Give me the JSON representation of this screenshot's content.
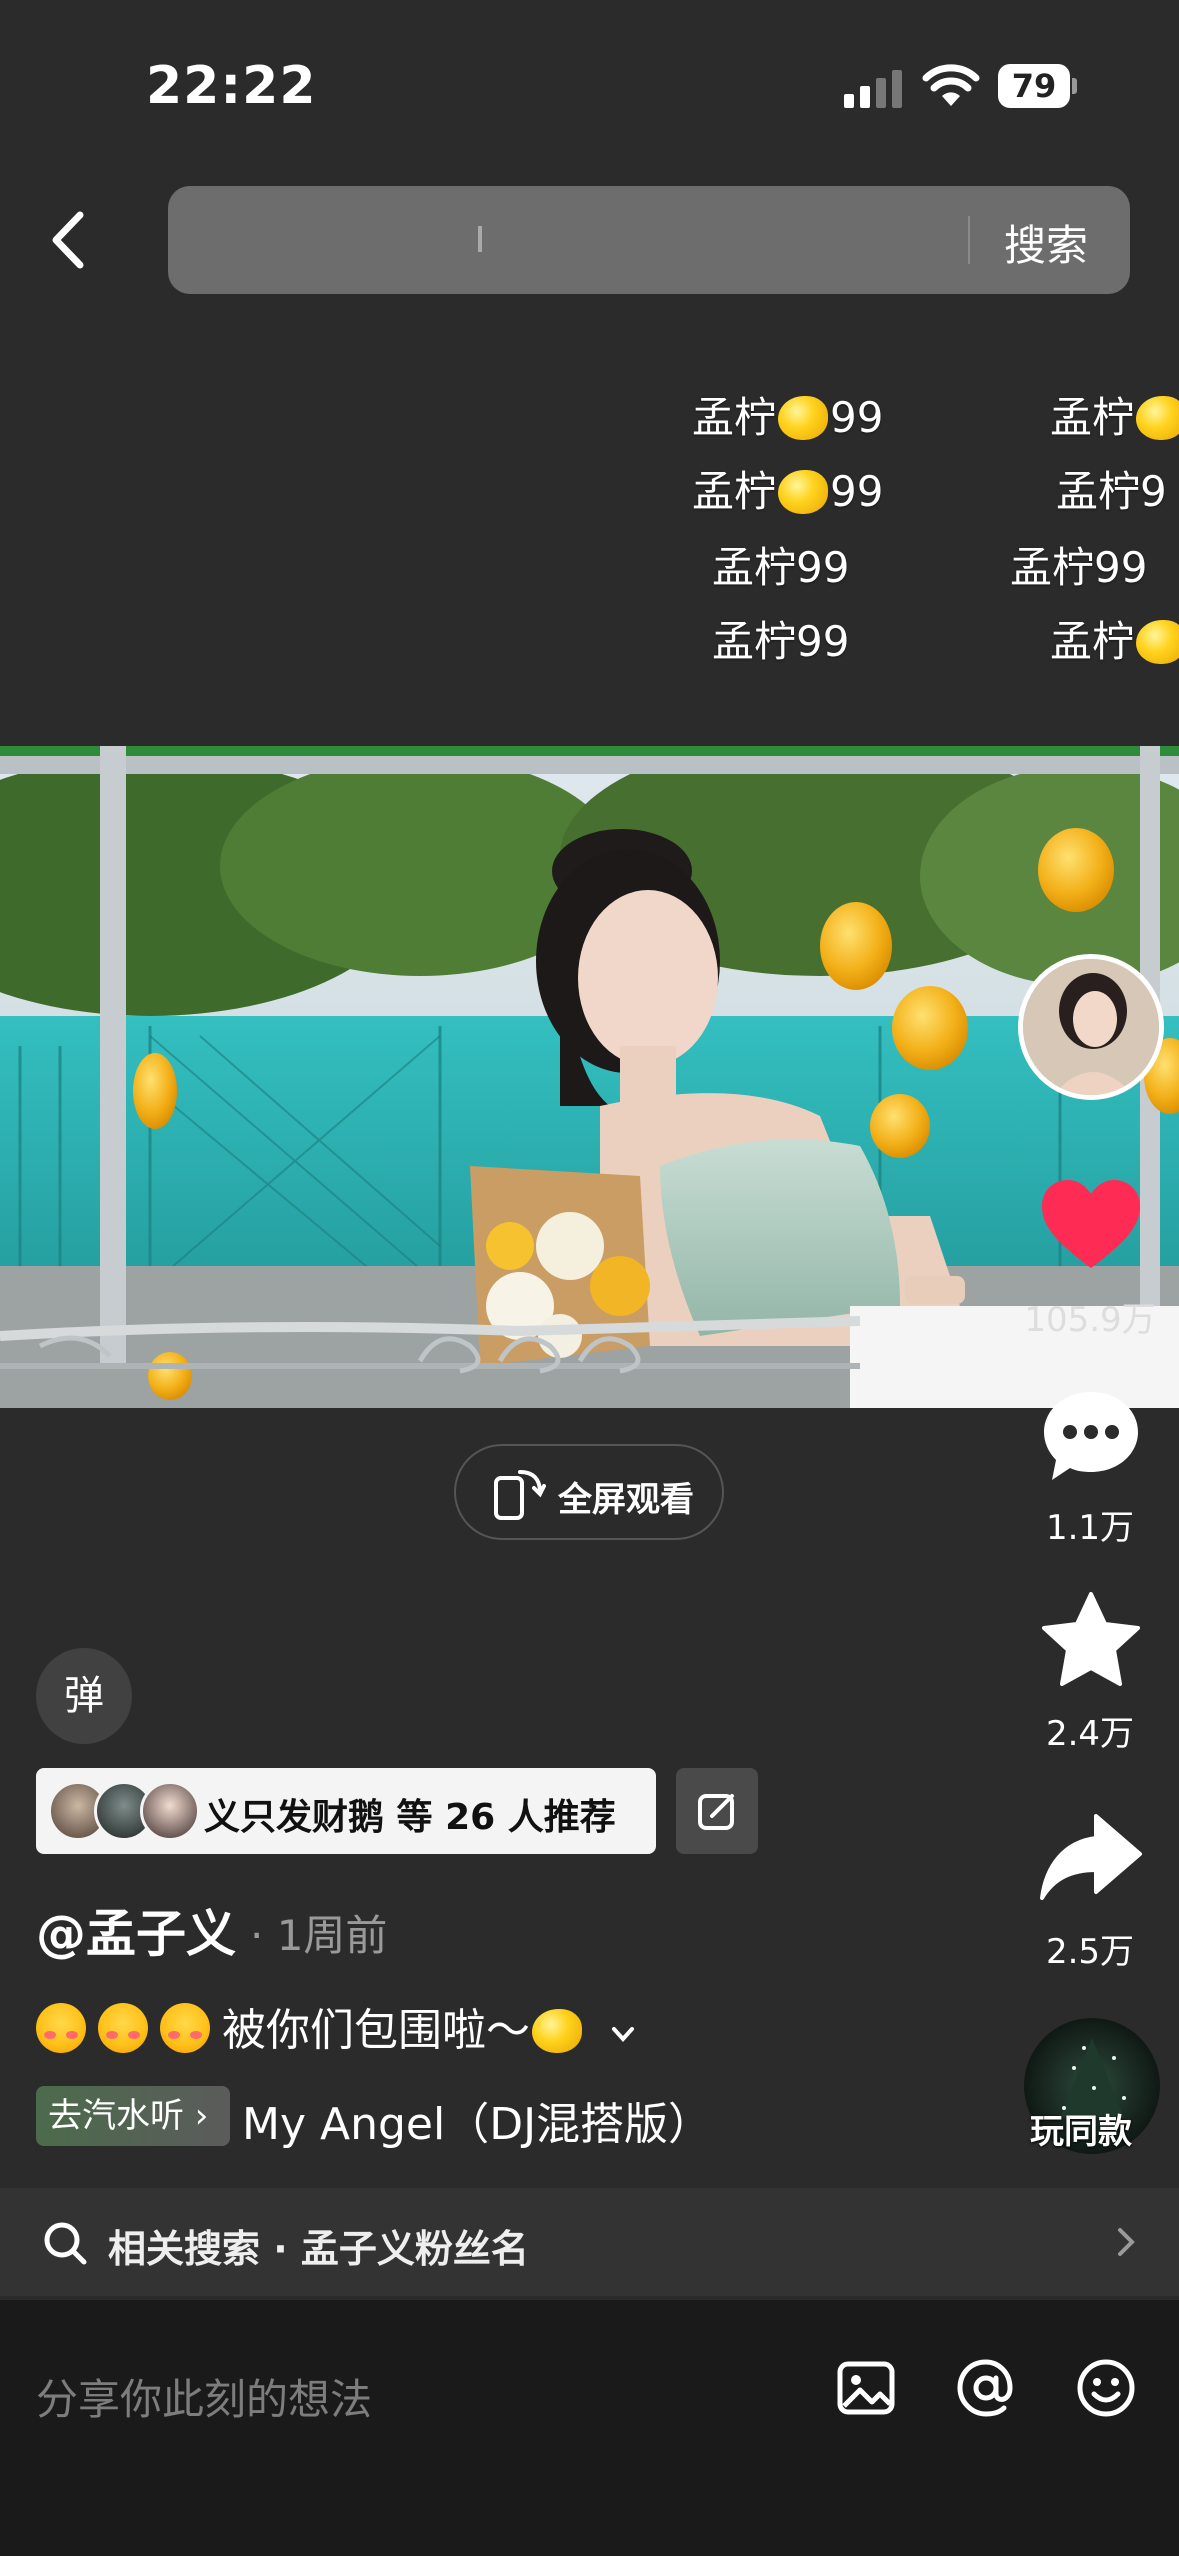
{
  "status_bar": {
    "time": "22:22",
    "battery": "79"
  },
  "search": {
    "placeholder": "",
    "button_label": "搜索"
  },
  "danmaku": [
    {
      "left": "孟柠",
      "right": "99"
    },
    {
      "left": "孟柠",
      "right": "99"
    },
    {
      "text": "孟柠99"
    },
    {
      "text": "孟柠99"
    },
    {
      "left": "孟柠"
    },
    {
      "text": "孟柠9"
    },
    {
      "text": "孟柠99"
    },
    {
      "left": "孟柠"
    }
  ],
  "actions": {
    "likes": "105.9万",
    "comments": "1.1万",
    "favorites": "2.4万",
    "shares": "2.5万"
  },
  "fullscreen": {
    "label": "全屏观看"
  },
  "danmaku_toggle": {
    "label": "弹"
  },
  "recommend": {
    "text": "义只发财鹅 等 26 人推荐"
  },
  "post": {
    "author": "@孟子义",
    "time_ago": "· 1周前",
    "caption": "被你们包围啦～",
    "music_tag": "去汽水听 ›",
    "music_title": "My Angel（DJ混搭版）",
    "play_same": "玩同款"
  },
  "related_search": {
    "text": "相关搜索 · 孟子义粉丝名"
  },
  "comment_bar": {
    "placeholder": "分享你此刻的想法"
  },
  "colors": {
    "like": "#fe2c55",
    "background": "#2b2b2b"
  }
}
